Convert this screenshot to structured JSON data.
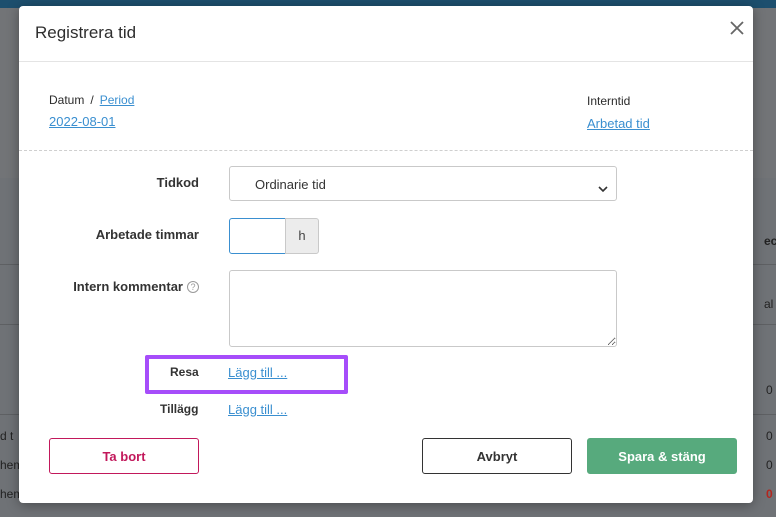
{
  "background": {
    "edge_fragments": [
      "ec",
      "al",
      "0",
      "d t",
      "0",
      "hem",
      "0",
      "hem",
      "0"
    ]
  },
  "dialog": {
    "title": "Registrera tid",
    "date_label": "Datum",
    "date_separator": "/",
    "period_link": "Period",
    "date_value": "2022-08-01",
    "intern_label": "Interntid",
    "intern_value": "Arbetad tid",
    "tidkod_label": "Tidkod",
    "tidkod_value": "Ordinarie tid",
    "hours_label": "Arbetade timmar",
    "hours_value": "",
    "hours_unit": "h",
    "comment_label": "Intern kommentar",
    "comment_help": "?",
    "comment_value": "",
    "resa_label": "Resa",
    "resa_link": "Lägg till ...",
    "tillagg_label": "Tillägg",
    "tillagg_link": "Lägg till ...",
    "delete_button": "Ta bort",
    "cancel_button": "Avbryt",
    "save_button": "Spara & stäng"
  },
  "colors": {
    "link": "#3a8fd0",
    "delete": "#c2185b",
    "save": "#57aa7d",
    "highlight": "#a64dfa"
  }
}
